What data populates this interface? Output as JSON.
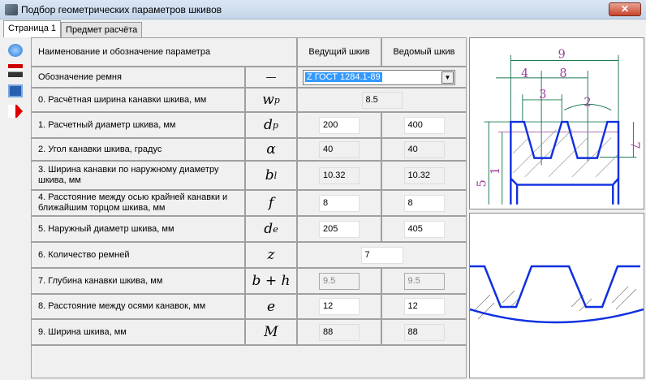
{
  "window": {
    "title": "Подбор геометрических параметров шкивов",
    "close": "✕"
  },
  "tabs": [
    {
      "label": "Страница 1"
    },
    {
      "label": "Предмет расчёта"
    }
  ],
  "header": {
    "name": "Наименование и обозначение параметра",
    "driving": "Ведущий шкив",
    "driven": "Ведомый шкив"
  },
  "belt": {
    "label": "Обозначение ремня",
    "symbol": "—",
    "value": "Z ГОСТ 1284.1-89"
  },
  "rows": [
    {
      "label": "0. Расчётная ширина канавки шкива, мм",
      "symbol": "w",
      "sub": "p",
      "value": "8.5"
    },
    {
      "label": "1. Расчетный диаметр шкива, мм",
      "symbol": "d",
      "sub": "p",
      "left": "200",
      "right": "400"
    },
    {
      "label": "2. Угол канавки шкива, градус",
      "symbol": "α",
      "sub": "",
      "left": "40",
      "right": "40"
    },
    {
      "label": "3. Ширина канавки по наружному диаметру шкива, мм",
      "symbol": "b",
      "sub": "l",
      "left": "10.32",
      "right": "10.32"
    },
    {
      "label": "4. Расстояние между осью крайней канавки и ближайшим торцом шкива, мм",
      "symbol": "f",
      "sub": "",
      "left": "8",
      "right": "8"
    },
    {
      "label": "5. Наружный диаметр шкива, мм",
      "symbol": "d",
      "sub": "e",
      "left": "205",
      "right": "405"
    },
    {
      "label": "6. Количество ремней",
      "symbol": "z",
      "sub": "",
      "value": "7"
    },
    {
      "label": "7. Глубина канавки шкива, мм",
      "symbol": "b + h",
      "sub": "",
      "left": "9.5",
      "right": "9.5"
    },
    {
      "label": "8. Расстояние между осями канавок, мм",
      "symbol": "e",
      "sub": "",
      "left": "12",
      "right": "12"
    },
    {
      "label": "9. Ширина шкива, мм",
      "symbol": "M",
      "sub": "",
      "left": "88",
      "right": "88"
    }
  ],
  "drawing": {
    "dims": [
      "9",
      "4",
      "8",
      "3",
      "2",
      "7",
      "1",
      "5"
    ]
  }
}
